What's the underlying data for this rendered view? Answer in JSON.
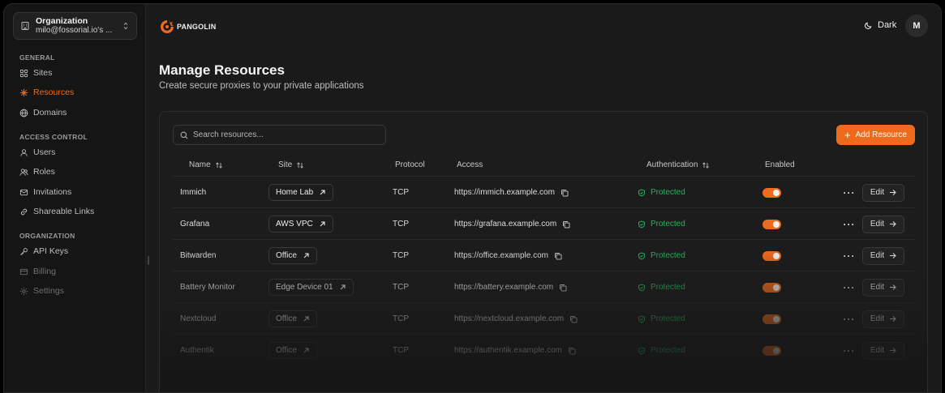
{
  "sidebar": {
    "org": {
      "title": "Organization",
      "subtitle": "milo@fossorial.io's ..."
    },
    "sections": [
      {
        "label": "GENERAL"
      },
      {
        "label": "ACCESS CONTROL"
      },
      {
        "label": "ORGANIZATION"
      }
    ],
    "items": [
      {
        "label": "Sites",
        "icon": "sites-icon"
      },
      {
        "label": "Resources",
        "icon": "resources-icon",
        "active": true
      },
      {
        "label": "Domains",
        "icon": "globe-icon"
      },
      {
        "label": "Users",
        "icon": "user-icon"
      },
      {
        "label": "Roles",
        "icon": "users-icon"
      },
      {
        "label": "Invitations",
        "icon": "mail-icon"
      },
      {
        "label": "Shareable Links",
        "icon": "link-icon"
      },
      {
        "label": "API Keys",
        "icon": "key-icon"
      },
      {
        "label": "Billing",
        "icon": "card-icon"
      },
      {
        "label": "Settings",
        "icon": "gear-icon"
      }
    ]
  },
  "header": {
    "brand": "PANGOLIN",
    "theme_label": "Dark",
    "avatar_initial": "M"
  },
  "main": {
    "title": "Manage Resources",
    "subtitle": "Create secure proxies to your private applications",
    "search_placeholder": "Search resources...",
    "add_button": "Add Resource",
    "columns": [
      "Name",
      "Site",
      "Protocol",
      "Access",
      "Authentication",
      "Enabled"
    ],
    "rows": [
      {
        "name": "Immich",
        "site": "Home Lab",
        "protocol": "TCP",
        "access": "https://immich.example.com",
        "auth": "Protected",
        "enabled": true,
        "edit": "Edit"
      },
      {
        "name": "Grafana",
        "site": "AWS VPC",
        "protocol": "TCP",
        "access": "https://grafana.example.com",
        "auth": "Protected",
        "enabled": true,
        "edit": "Edit"
      },
      {
        "name": "Bitwarden",
        "site": "Office",
        "protocol": "TCP",
        "access": "https://office.example.com",
        "auth": "Protected",
        "enabled": true,
        "edit": "Edit"
      },
      {
        "name": "Battery Monitor",
        "site": "Edge Device 01",
        "protocol": "TCP",
        "access": "https://battery.example.com",
        "auth": "Protected",
        "enabled": true,
        "edit": "Edit"
      },
      {
        "name": "Nextcloud",
        "site": "Office",
        "protocol": "TCP",
        "access": "https://nextcloud.example.com",
        "auth": "Protected",
        "enabled": true,
        "edit": "Edit"
      },
      {
        "name": "Authentik",
        "site": "Office",
        "protocol": "TCP",
        "access": "https://authentik.example.com",
        "auth": "Protected",
        "enabled": true,
        "edit": "Edit"
      }
    ]
  },
  "colors": {
    "accent": "#ee6a1d",
    "protected": "#25b35c",
    "background": "#1a1a1a"
  }
}
